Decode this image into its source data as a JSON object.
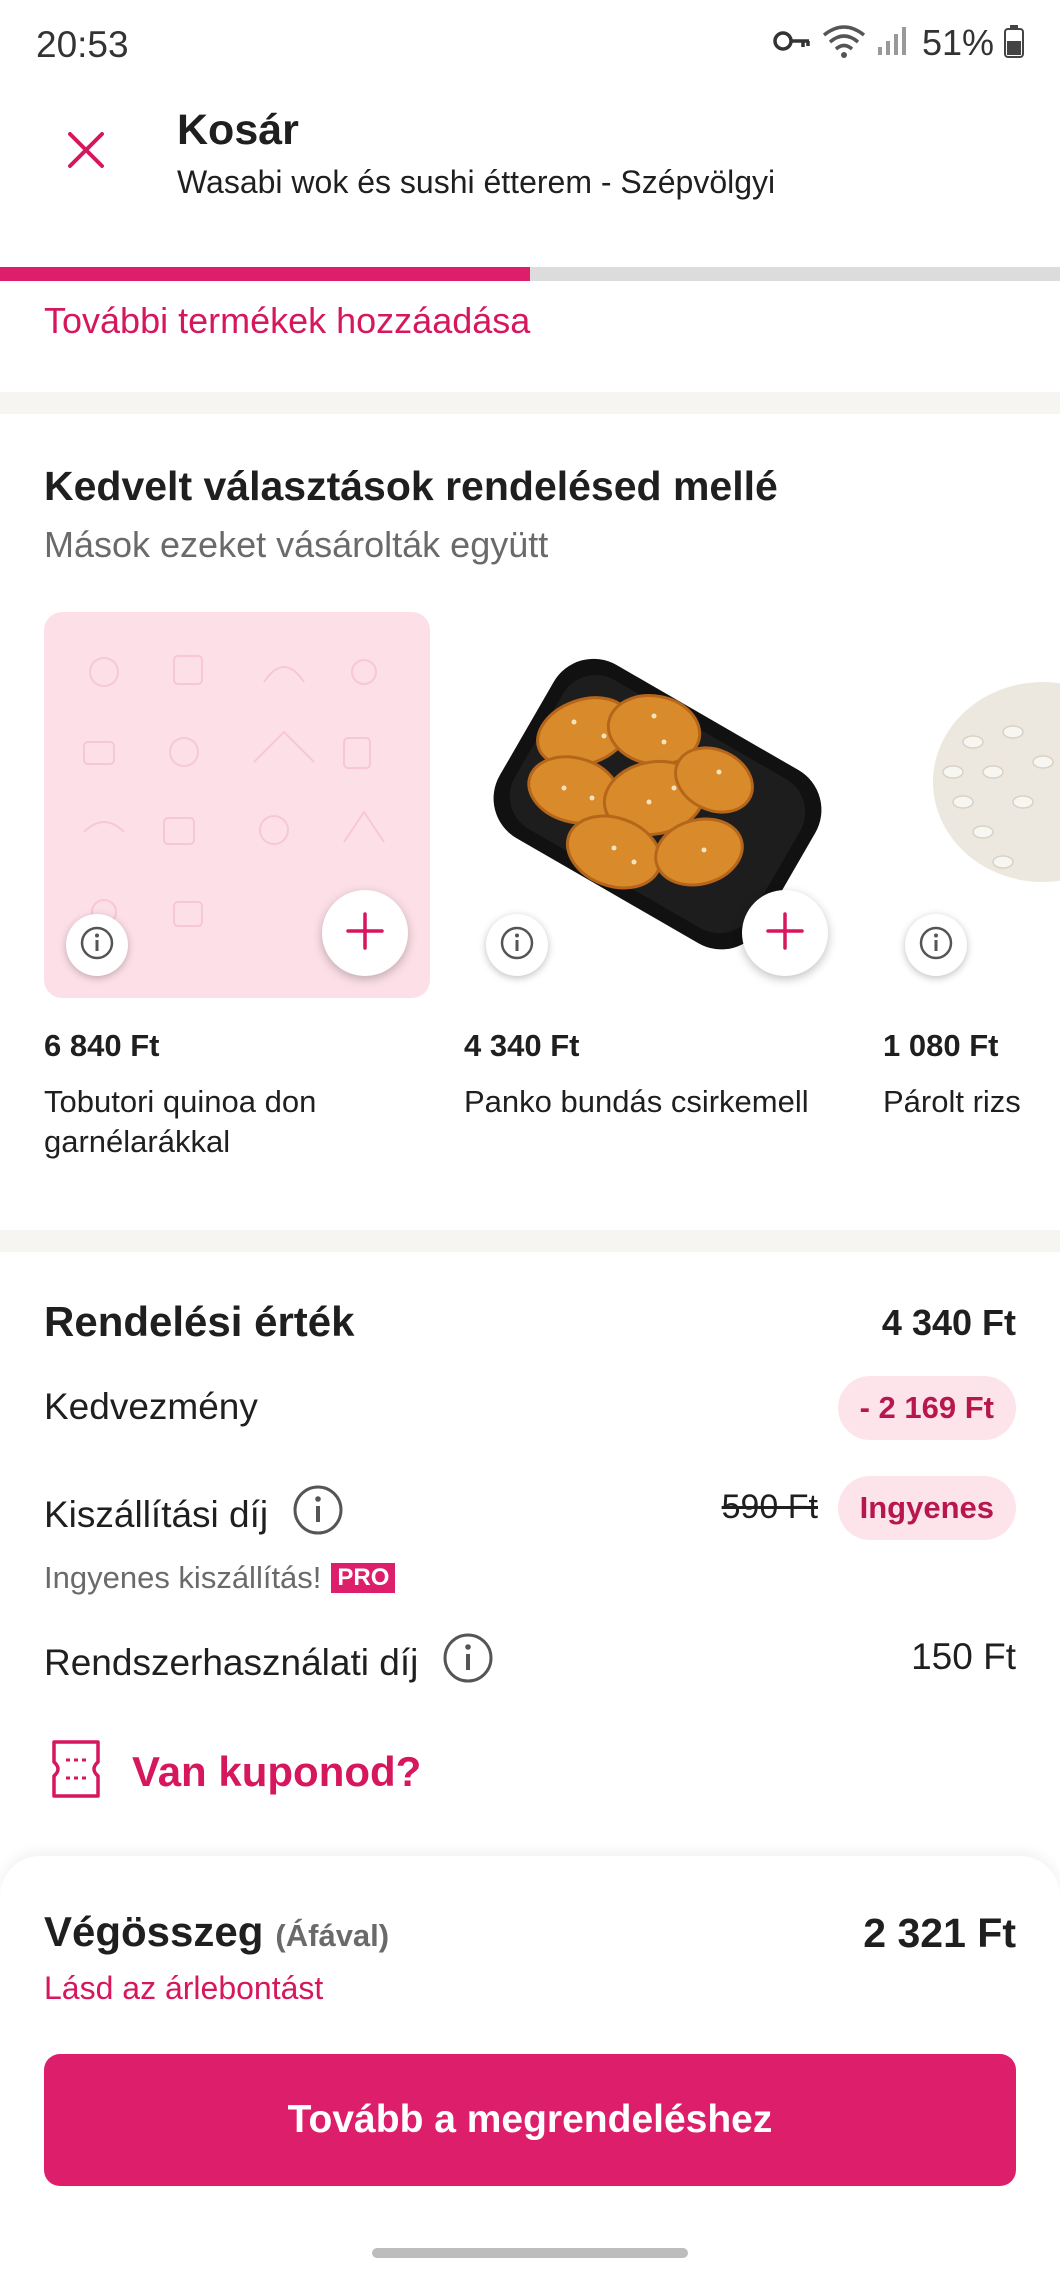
{
  "status_bar": {
    "time": "20:53",
    "battery": "51%",
    "icons": [
      "key-icon",
      "wifi-icon",
      "signal-icon",
      "battery-icon"
    ]
  },
  "header": {
    "title": "Kosár",
    "subtitle": "Wasabi wok és sushi étterem - Szépvölgyi",
    "close_icon": "close-icon"
  },
  "progress": {
    "value": 0.5
  },
  "add_more_label": "További termékek hozzáadása",
  "suggestions": {
    "title": "Kedvelt választások rendelésed mellé",
    "subtitle": "Mások ezeket vásárolták együtt",
    "items": [
      {
        "price": "6 840 Ft",
        "name": "Tobutori quinoa don garnélarákkal"
      },
      {
        "price": "4 340 Ft",
        "name": "Panko bundás csirkemell"
      },
      {
        "price": "1 080 Ft",
        "name": "Párolt rizs"
      }
    ]
  },
  "summary": {
    "order_value_label": "Rendelési érték",
    "order_value": "4 340 Ft",
    "discount_label": "Kedvezmény",
    "discount_value": "- 2 169 Ft",
    "delivery_label": "Kiszállítási díj",
    "delivery_old": "590 Ft",
    "delivery_value": "Ingyenes",
    "free_delivery_note": "Ingyenes kiszállítás!",
    "pro_badge": "PRO",
    "service_fee_label": "Rendszerhasználati díj",
    "service_fee_value": "150 Ft",
    "coupon_label": "Van kuponod?"
  },
  "total": {
    "label": "Végösszeg",
    "vat_note": "(Áfával)",
    "value": "2 321 Ft",
    "breakdown_link": "Lásd az árlebontást",
    "checkout_label": "Tovább a megrendeléshez"
  },
  "colors": {
    "accent": "#dd1f6b",
    "accent_text": "#d6175e",
    "pill_bg": "#fde4ea"
  }
}
